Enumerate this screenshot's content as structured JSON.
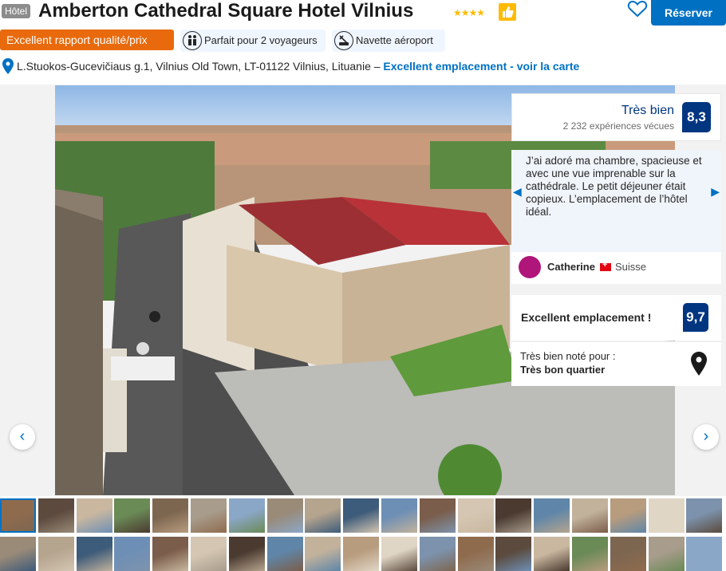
{
  "header": {
    "type_badge": "Hôtel",
    "title": "Amberton Cathedral Square Hotel Vilnius",
    "stars": "★★★★",
    "reserve_label": "Réserver"
  },
  "chips": {
    "value_label": "Excellent rapport qualité/prix",
    "couple_label": "Parfait pour 2 voyageurs",
    "shuttle_label": "Navette aéroport"
  },
  "address": {
    "text": "L.Stuokos-Gucevičiaus g.1, Vilnius Old Town, LT-01122 Vilnius, Lituanie –",
    "map_link": "Excellent emplacement - voir la carte"
  },
  "review": {
    "score_word": "Très bien",
    "score_count": "2 232 expériences vécues",
    "score_value": "8,3",
    "quote": "J’ai adoré ma chambre, spacieuse et avec une vue imprenable sur la cathédrale. Le petit déjeuner était copieux. L’emplacement de l’hôtel idéal.",
    "reviewer_name": "Catherine",
    "reviewer_country": "Suisse",
    "location_title": "Excellent emplacement !",
    "location_score": "9,7",
    "feature_label": "Très bien noté pour :",
    "feature_value": "Très bon quartier"
  },
  "colors": {
    "brand_blue": "#0071c2",
    "dark_blue": "#003580",
    "orange": "#e86a0c",
    "star_yellow": "#febb02"
  },
  "icons": {
    "prev_arrow": "‹",
    "next_arrow": "›",
    "quote_prev": "◀",
    "quote_next": "▶"
  }
}
